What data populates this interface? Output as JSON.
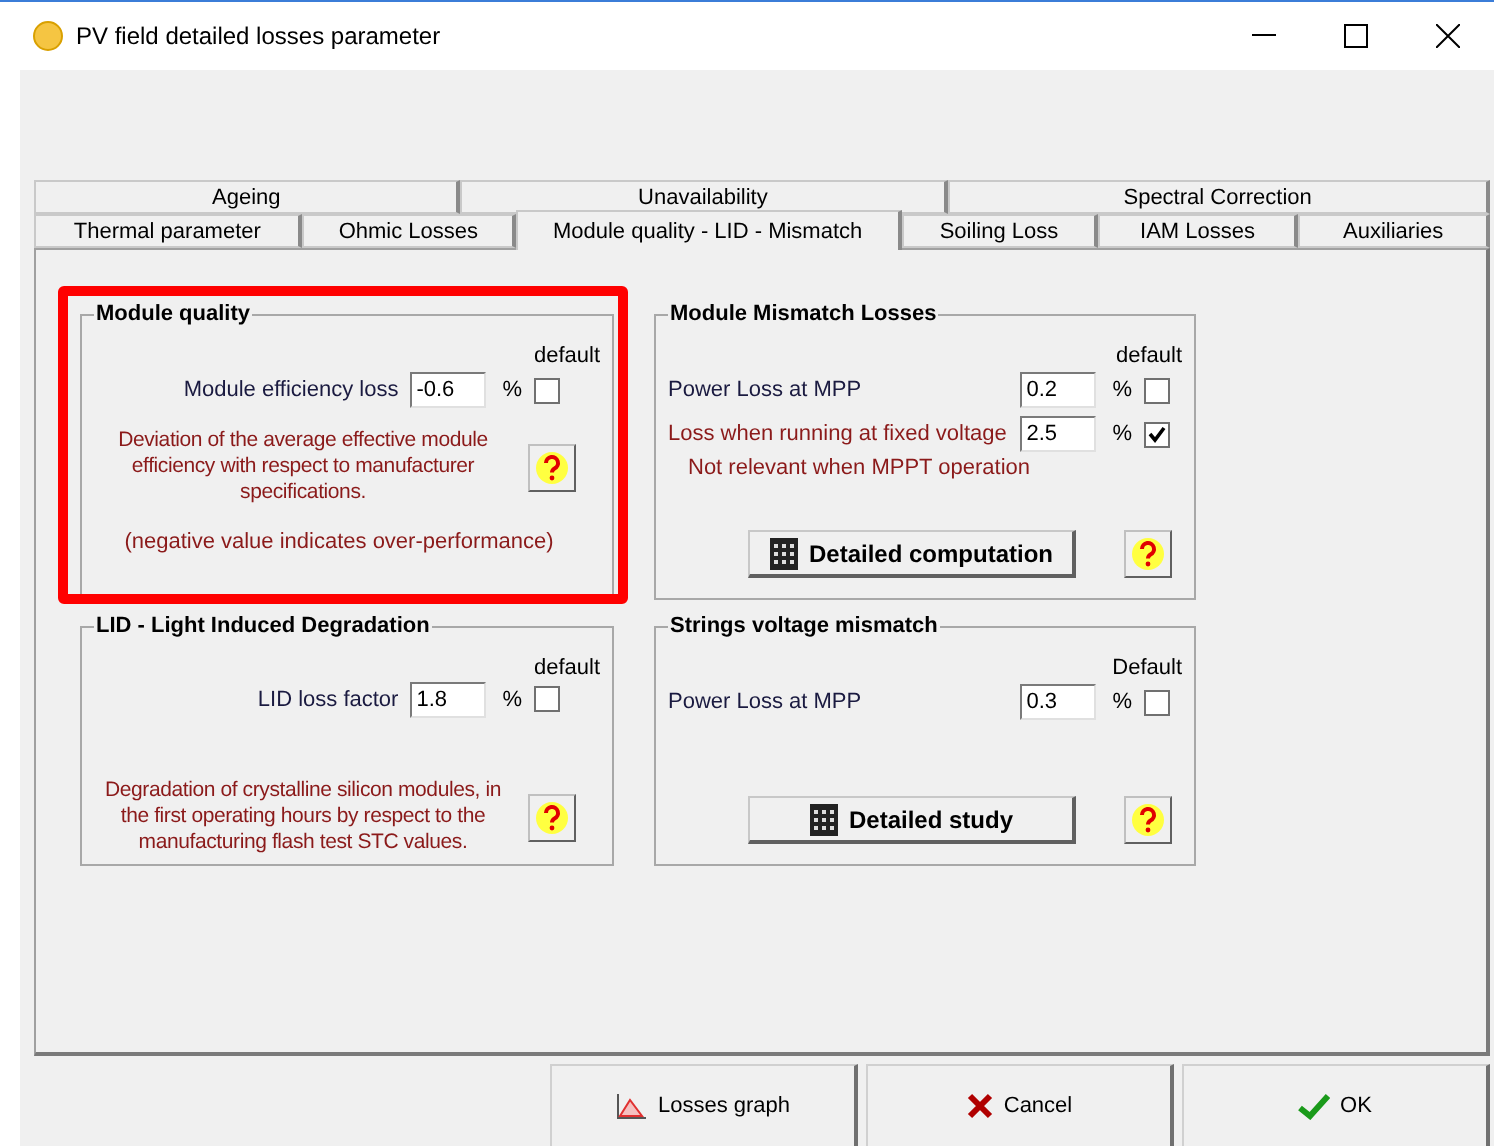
{
  "window": {
    "title": "PV field detailed losses parameter"
  },
  "tab_rows": [
    {
      "tabs": [
        {
          "label": "Ageing",
          "selected": false
        },
        {
          "label": "Unavailability",
          "selected": false
        },
        {
          "label": "Spectral Correction",
          "selected": false
        }
      ]
    },
    {
      "tabs": [
        {
          "label": "Thermal parameter",
          "selected": false
        },
        {
          "label": "Ohmic Losses",
          "selected": false
        },
        {
          "label": "Module quality - LID - Mismatch",
          "selected": true
        },
        {
          "label": "Soiling Loss",
          "selected": false
        },
        {
          "label": "IAM Losses",
          "selected": false
        },
        {
          "label": "Auxiliaries",
          "selected": false
        }
      ]
    }
  ],
  "groups": [
    {
      "kind": "description",
      "title": "Module quality",
      "highlighted": true,
      "default_label": "default",
      "fields": [
        {
          "label": "Module efficiency loss",
          "value": "-0.6",
          "unit": "%",
          "default_checked": false,
          "warning": false
        }
      ],
      "description": "Deviation of the average effective module efficiency with respect to manufacturer specifications.",
      "note": "(negative value indicates over-performance)"
    },
    {
      "kind": "action",
      "title": "Module Mismatch Losses",
      "highlighted": false,
      "default_label": "default",
      "fields": [
        {
          "label": "Power Loss at MPP",
          "value": "0.2",
          "unit": "%",
          "default_checked": false,
          "warning": false
        },
        {
          "label": "Loss when running at fixed voltage",
          "value": "2.5",
          "unit": "%",
          "default_checked": true,
          "warning": true,
          "note": "Not relevant when MPPT operation"
        }
      ],
      "button": "Detailed computation"
    },
    {
      "kind": "description",
      "title": "LID - Light Induced Degradation",
      "highlighted": false,
      "default_label": "default",
      "fields": [
        {
          "label": "LID loss factor",
          "value": "1.8",
          "unit": "%",
          "default_checked": false,
          "warning": false
        }
      ],
      "description": "Degradation of crystalline silicon modules, in the first operating hours by respect to the manufacturing flash test STC values."
    },
    {
      "kind": "action",
      "title": "Strings voltage mismatch",
      "highlighted": false,
      "default_label": "Default",
      "fields": [
        {
          "label": "Power Loss at MPP",
          "value": "0.3",
          "unit": "%",
          "default_checked": false,
          "warning": false
        }
      ],
      "button": "Detailed study"
    }
  ],
  "buttons": [
    {
      "kind": "graph",
      "label": "Losses graph"
    },
    {
      "kind": "cancel",
      "label": "Cancel"
    },
    {
      "kind": "ok",
      "label": "OK"
    }
  ]
}
